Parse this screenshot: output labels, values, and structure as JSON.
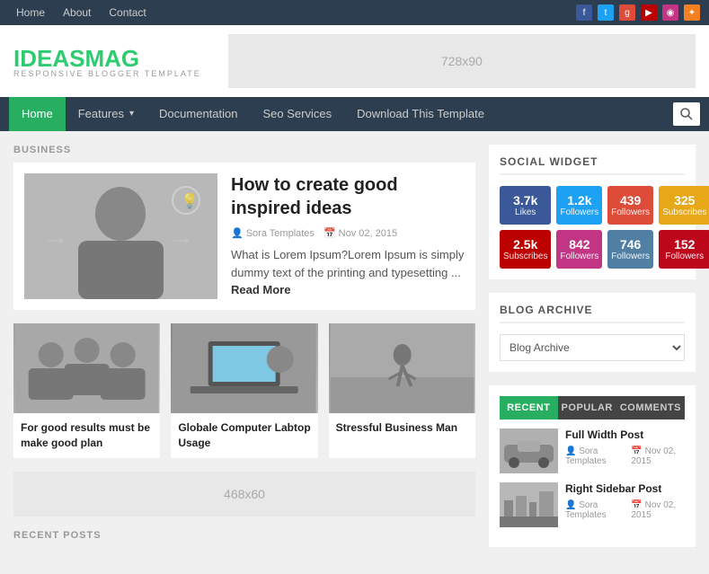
{
  "topnav": {
    "links": [
      {
        "label": "Home",
        "active": true
      },
      {
        "label": "About"
      },
      {
        "label": "Contact"
      }
    ],
    "social_icons": [
      "facebook",
      "twitter",
      "google-plus",
      "youtube",
      "instagram",
      "stackoverflow"
    ]
  },
  "header": {
    "logo_text1": "IDEAS",
    "logo_text2": "MAG",
    "logo_sub": "RESPONSIVE BLOGGER TEMPLATE",
    "ad_label": "728x90"
  },
  "mainnav": {
    "items": [
      {
        "label": "Home",
        "active": true
      },
      {
        "label": "Features",
        "has_dropdown": true
      },
      {
        "label": "Documentation"
      },
      {
        "label": "Seo Services"
      },
      {
        "label": "Download This Template"
      }
    ]
  },
  "main": {
    "section_label": "BUSINESS",
    "featured": {
      "title": "How to create good inspired ideas",
      "author": "Sora Templates",
      "date": "Nov 02, 2015",
      "excerpt": "What is Lorem Ipsum?Lorem Ipsum is simply dummy text of the printing and typesetting ...",
      "read_more": "Read More"
    },
    "grid_posts": [
      {
        "title": "For good results must be make good plan",
        "img_class": "img-teamwork"
      },
      {
        "title": "Globale Computer Labtop Usage",
        "img_class": "img-laptop"
      },
      {
        "title": "Stressful Business Man",
        "img_class": "img-runner"
      }
    ],
    "ad_label": "468x60",
    "recent_posts_label": "RECENT POSTS"
  },
  "sidebar": {
    "social_widget_title": "SOCIAL WIDGET",
    "social_boxes": [
      {
        "label": "Likes",
        "count": "3.7k",
        "class": "sb-fb",
        "icon": "f"
      },
      {
        "label": "Followers",
        "count": "1.2k",
        "class": "sb-tw",
        "icon": "t"
      },
      {
        "label": "Followers",
        "count": "439",
        "class": "sb-gp",
        "icon": "g+"
      },
      {
        "label": "Subscribes",
        "count": "325",
        "class": "sb-rss",
        "icon": "rss"
      },
      {
        "label": "Subscribes",
        "count": "2.5k",
        "class": "sb-yt",
        "icon": "yt"
      },
      {
        "label": "Followers",
        "count": "842",
        "class": "sb-ig",
        "icon": "ig"
      },
      {
        "label": "Followers",
        "count": "746",
        "class": "sb-cam",
        "icon": "cam"
      },
      {
        "label": "Followers",
        "count": "152",
        "class": "sb-pi",
        "icon": "pi"
      }
    ],
    "blog_archive_title": "BLOG ARCHIVE",
    "blog_archive_placeholder": "Blog Archive",
    "tabs": [
      {
        "label": "RECENT",
        "active": true
      },
      {
        "label": "POPULAR"
      },
      {
        "label": "COMMENTS"
      }
    ],
    "recent_posts": [
      {
        "title": "Full Width Post",
        "author": "Sora Templates",
        "date": "Nov 02, 2015",
        "img_class": "img-car"
      },
      {
        "title": "Right Sidebar Post",
        "author": "Sora Templates",
        "date": "Nov 02, 2015",
        "img_class": "img-city"
      }
    ]
  }
}
